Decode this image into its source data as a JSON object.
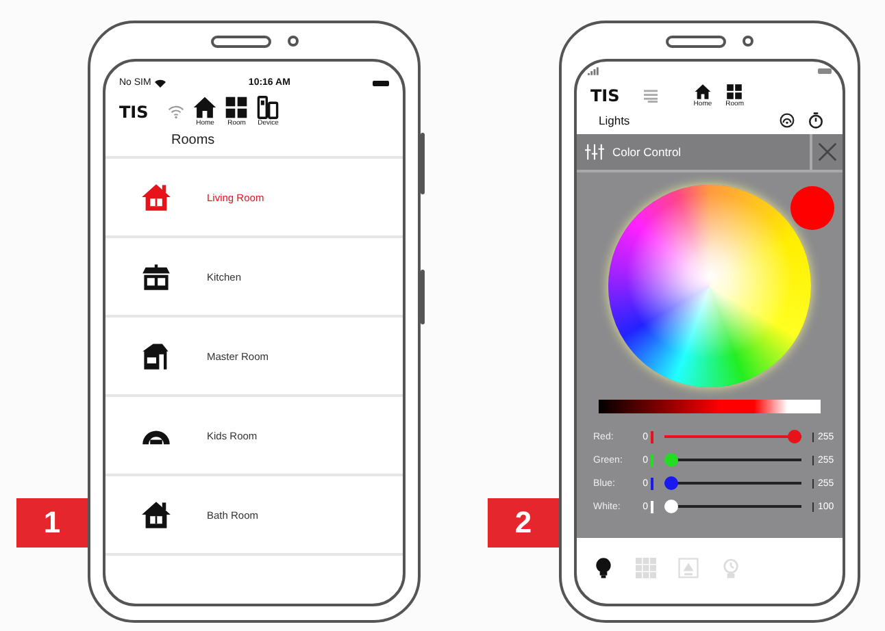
{
  "phones": [
    {
      "kind": "rooms",
      "badge": "1",
      "status_bar": {
        "carrier": "No SIM",
        "time": "10:16 AM"
      },
      "header": {
        "logo": "TIS",
        "nav": [
          {
            "kind": "home",
            "label": "Home"
          },
          {
            "kind": "room",
            "label": "Room"
          },
          {
            "kind": "device",
            "label": "Device"
          }
        ]
      },
      "title": "Rooms",
      "rooms": [
        {
          "kind": "house",
          "name": "Living Room",
          "selected": true
        },
        {
          "kind": "shop",
          "name": "Kitchen",
          "selected": false
        },
        {
          "kind": "barn",
          "name": "Master Room",
          "selected": false
        },
        {
          "kind": "dome",
          "name": "Kids Room",
          "selected": false
        },
        {
          "kind": "house",
          "name": "Bath Room",
          "selected": false
        }
      ]
    },
    {
      "kind": "color",
      "badge": "2",
      "header": {
        "logo": "TIS",
        "nav": [
          {
            "kind": "home",
            "label": "Home"
          },
          {
            "kind": "room",
            "label": "Room"
          }
        ]
      },
      "section": "Lights",
      "panel": {
        "title": "Color Control",
        "sliders": [
          {
            "label": "Red:",
            "min": "0",
            "max": "255",
            "level": 1,
            "color": "#e8121a"
          },
          {
            "label": "Green:",
            "min": "0",
            "max": "255",
            "level": 0,
            "color": "#22dd22"
          },
          {
            "label": "Blue:",
            "min": "0",
            "max": "255",
            "level": 0,
            "color": "#1a1aee"
          },
          {
            "label": "White:",
            "min": "0",
            "max": "100",
            "level": 0,
            "color": "#ffffff"
          }
        ]
      },
      "tabs": [
        {
          "kind": "bulb",
          "selected": true
        },
        {
          "kind": "grid",
          "selected": false
        },
        {
          "kind": "scene",
          "selected": false
        },
        {
          "kind": "timer",
          "selected": false
        }
      ]
    }
  ]
}
